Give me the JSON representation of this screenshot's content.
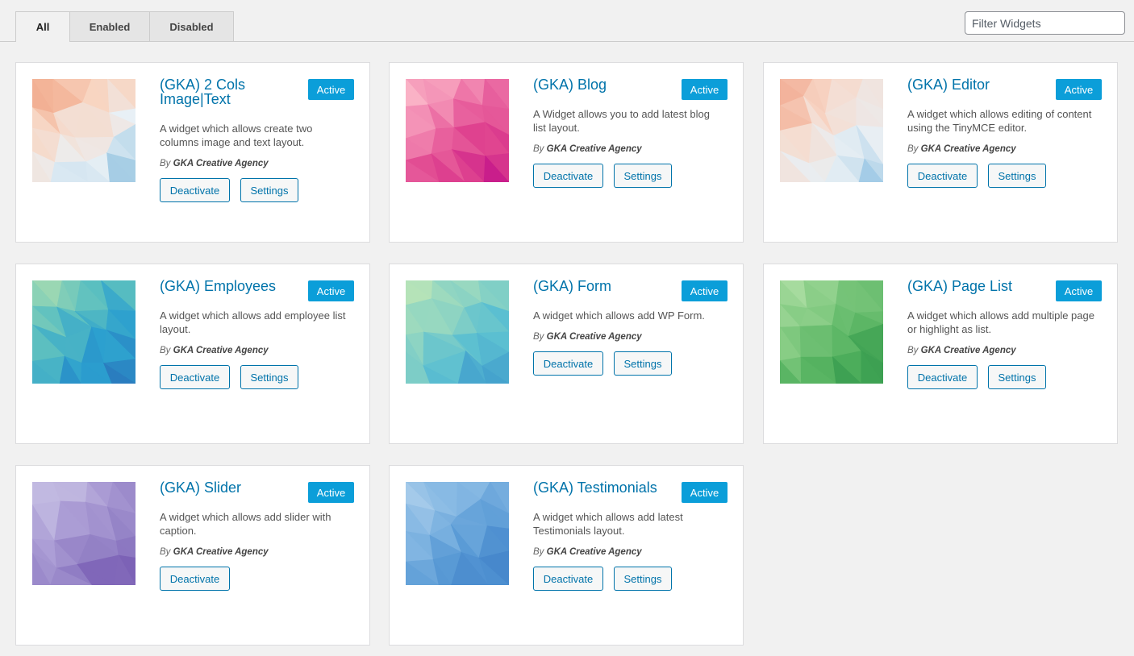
{
  "tabs": [
    {
      "label": "All",
      "active": true
    },
    {
      "label": "Enabled",
      "active": false
    },
    {
      "label": "Disabled",
      "active": false
    }
  ],
  "filter": {
    "placeholder": "Filter Widgets",
    "value": ""
  },
  "widgets": [
    {
      "title": "(GKA) 2 Cols Image|Text",
      "status": "Active",
      "description": "A widget which allows create two columns image and text layout.",
      "author_prefix": "By",
      "author": "GKA Creative Agency",
      "deactivate_label": "Deactivate",
      "settings_label": "Settings",
      "thumbnail_colors": [
        "#f0a080",
        "#f8d4c0",
        "#eaf1f6",
        "#9ac7e2"
      ],
      "thumbnail_icon": "polygon-pattern-peach-blue"
    },
    {
      "title": "(GKA) Blog",
      "status": "Active",
      "description": "A Widget allows you to add latest blog list layout.",
      "author_prefix": "By",
      "author": "GKA Creative Agency",
      "deactivate_label": "Deactivate",
      "settings_label": "Settings",
      "thumbnail_colors": [
        "#fbb9c9",
        "#ef7bab",
        "#e0448f",
        "#c4168a"
      ],
      "thumbnail_icon": "polygon-pattern-pink"
    },
    {
      "title": "(GKA) Editor",
      "status": "Active",
      "description": "A widget which allows editing of content using the TinyMCE editor.",
      "author_prefix": "By",
      "author": "GKA Creative Agency",
      "deactivate_label": "Deactivate",
      "settings_label": "Settings",
      "thumbnail_colors": [
        "#ee9376",
        "#f8d8c8",
        "#e8eff4",
        "#92c3e3"
      ],
      "thumbnail_icon": "polygon-pattern-peach-blue"
    },
    {
      "title": "(GKA) Employees",
      "status": "Active",
      "description": "A widget which allows add employee list layout.",
      "author_prefix": "By",
      "author": "GKA Creative Agency",
      "deactivate_label": "Deactivate",
      "settings_label": "Settings",
      "thumbnail_colors": [
        "#a6dcb0",
        "#5bbfc0",
        "#2b9fcf",
        "#2a6eb8"
      ],
      "thumbnail_icon": "polygon-pattern-teal-blue"
    },
    {
      "title": "(GKA) Form",
      "status": "Active",
      "description": "A widget which allows add WP Form.",
      "author_prefix": "By",
      "author": "GKA Creative Agency",
      "deactivate_label": "Deactivate",
      "settings_label": "Settings",
      "thumbnail_colors": [
        "#bde6b6",
        "#8fd5c2",
        "#5bbfd1",
        "#3a95cb"
      ],
      "thumbnail_icon": "polygon-pattern-mint-blue"
    },
    {
      "title": "(GKA) Page List",
      "status": "Active",
      "description": "A widget which allows add multiple page or highlight as list.",
      "author_prefix": "By",
      "author": "GKA Creative Agency",
      "deactivate_label": "Deactivate",
      "settings_label": "Settings",
      "thumbnail_colors": [
        "#b8e3ad",
        "#86cc84",
        "#52b15e",
        "#2d9449"
      ],
      "thumbnail_icon": "polygon-pattern-green"
    },
    {
      "title": "(GKA) Slider",
      "status": "Active",
      "description": "A widget which allows add slider with caption.",
      "author_prefix": "By",
      "author": "GKA Creative Agency",
      "deactivate_label": "Deactivate",
      "settings_label": "",
      "thumbnail_colors": [
        "#cfcbe8",
        "#ad9fd6",
        "#9482c6",
        "#6e4fad"
      ],
      "thumbnail_icon": "polygon-pattern-purple"
    },
    {
      "title": "(GKA) Testimonials",
      "status": "Active",
      "description": "A widget which allows add latest Testimonials layout.",
      "author_prefix": "By",
      "author": "GKA Creative Agency",
      "deactivate_label": "Deactivate",
      "settings_label": "Settings",
      "thumbnail_colors": [
        "#b3d3ee",
        "#82b6e2",
        "#5a9bd6",
        "#3a7cc6"
      ],
      "thumbnail_icon": "polygon-pattern-blue"
    }
  ],
  "colors": {
    "link": "#0073aa",
    "badge": "#0b9ed9",
    "background": "#f1f1f1"
  }
}
